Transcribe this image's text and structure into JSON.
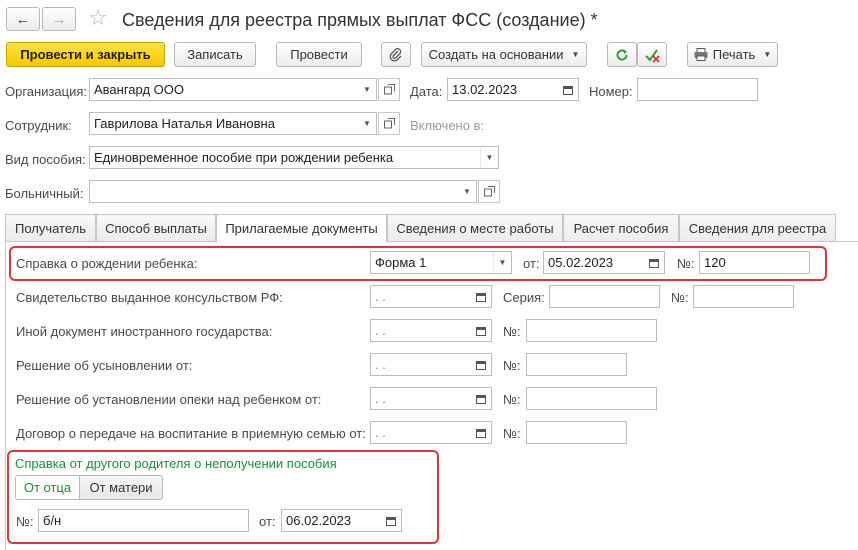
{
  "window": {
    "title": "Сведения для реестра прямых выплат ФСС (создание) *"
  },
  "toolbar": {
    "post_close_label": "Провести и закрыть",
    "save_label": "Записать",
    "post_label": "Провести",
    "create_based_label": "Создать на основании",
    "print_label": "Печать"
  },
  "form": {
    "organization_label": "Организация:",
    "organization_value": "Авангард ООО",
    "date_label": "Дата:",
    "date_value": "13.02.2023",
    "number_label": "Номер:",
    "number_value": "",
    "employee_label": "Сотрудник:",
    "employee_value": "Гаврилова Наталья Ивановна",
    "included_label": "Включено в:",
    "benefit_type_label": "Вид пособия:",
    "benefit_type_value": "Единовременное пособие при рождении ребенка",
    "sick_leave_label": "Больничный:",
    "sick_leave_value": ""
  },
  "tabs": [
    {
      "label": "Получатель"
    },
    {
      "label": "Способ выплаты"
    },
    {
      "label": "Прилагаемые документы"
    },
    {
      "label": "Сведения о месте работы"
    },
    {
      "label": "Расчет пособия"
    },
    {
      "label": "Сведения для реестра"
    }
  ],
  "docs": {
    "birth_cert_label": "Справка о рождении ребенка:",
    "birth_cert_form": "Форма 1",
    "from_label": "от:",
    "birth_cert_date": "05.02.2023",
    "no_label": "№:",
    "birth_cert_no": "120",
    "consul_label": "Свидетельство выданное консульством РФ:",
    "empty_date": " .  .",
    "series_label": "Серия:",
    "foreign_label": "Иной документ иностранного государства:",
    "adoption_label": "Решение об усыновлении от:",
    "guardianship_label": "Решение об установлении опеки над ребенком от:",
    "foster_label": "Договор о передаче на воспитание в приемную семью от:",
    "other_parent_title": "Справка от другого родителя о неполучении пособия",
    "from_father_label": "От отца",
    "from_mother_label": "От матери",
    "other_parent_no": "б/н",
    "other_parent_date": "06.02.2023"
  },
  "colors": {
    "primary_button": "#f6c800",
    "highlight_border": "#d9373a",
    "group_title": "#1a8f3c"
  }
}
